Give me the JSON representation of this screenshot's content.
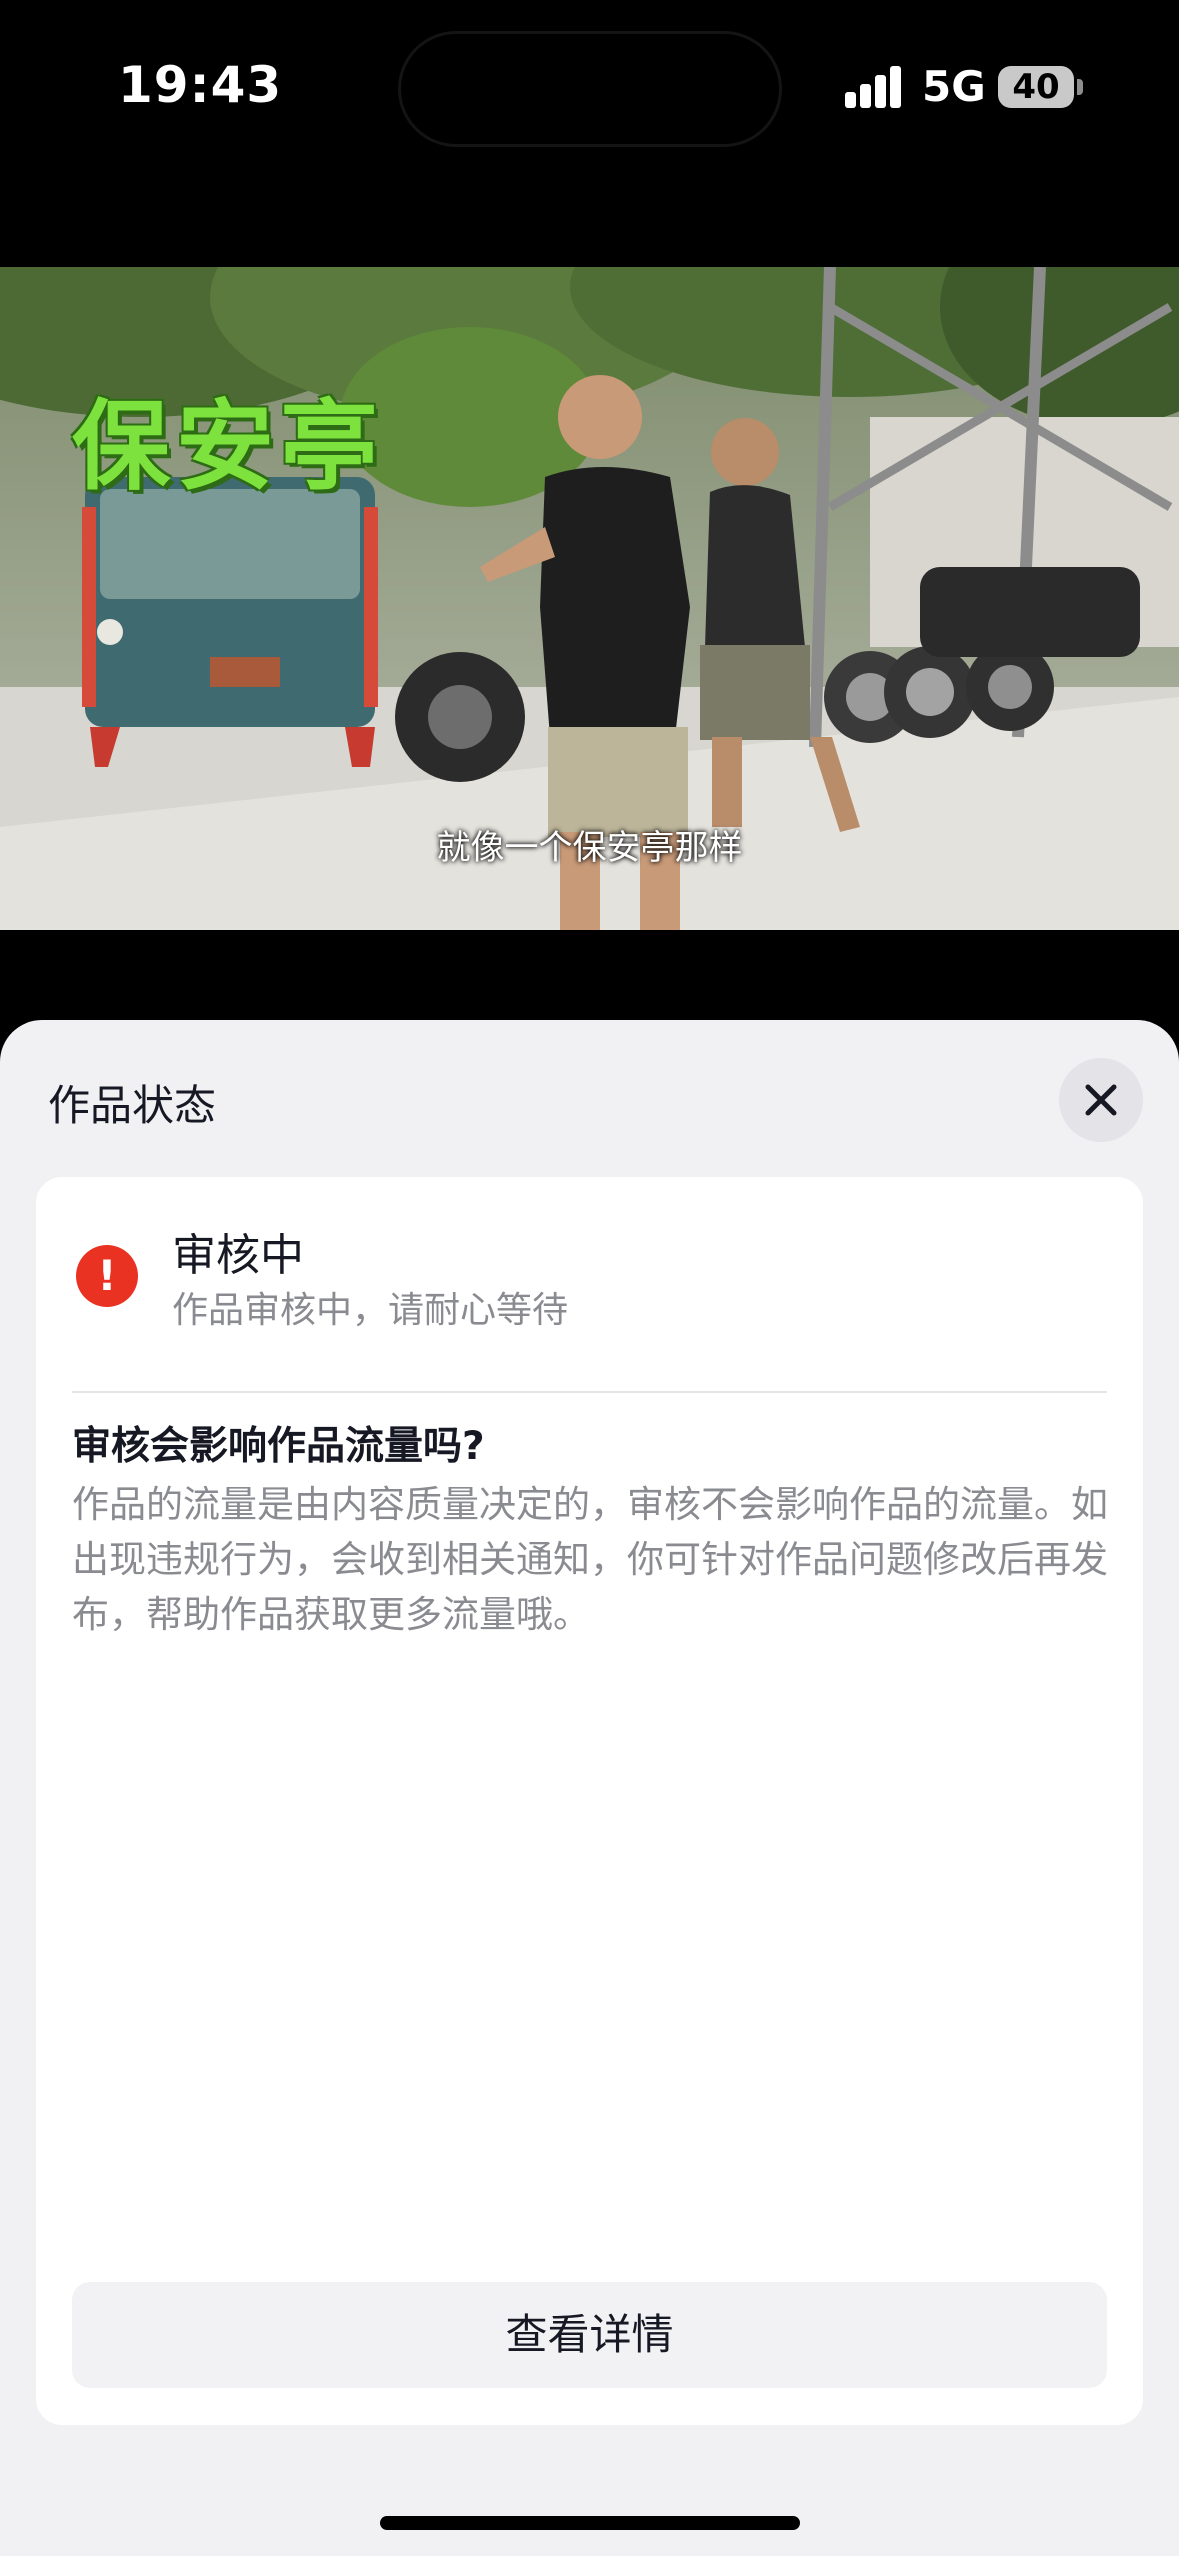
{
  "status_bar": {
    "time": "19:43",
    "network": "5G",
    "battery": "40",
    "icons": [
      "signal-icon",
      "battery-icon"
    ]
  },
  "video": {
    "overlay_title": "保安亭",
    "subtitle": "就像一个保安亭那样",
    "colors": {
      "overlay_title": "#7ee23e"
    }
  },
  "sheet": {
    "title": "作品状态",
    "close_icon": "close-icon",
    "status": {
      "icon": "exclamation-icon",
      "title": "审核中",
      "description": "作品审核中，请耐心等待",
      "color": "#ea3222"
    },
    "faq": {
      "question": "审核会影响作品流量吗?",
      "answer": "作品的流量是由内容质量决定的，审核不会影响作品的流量。如出现违规行为，会收到相关通知，你可针对作品问题修改后再发布，帮助作品获取更多流量哦。"
    },
    "button_label": "查看详情"
  }
}
